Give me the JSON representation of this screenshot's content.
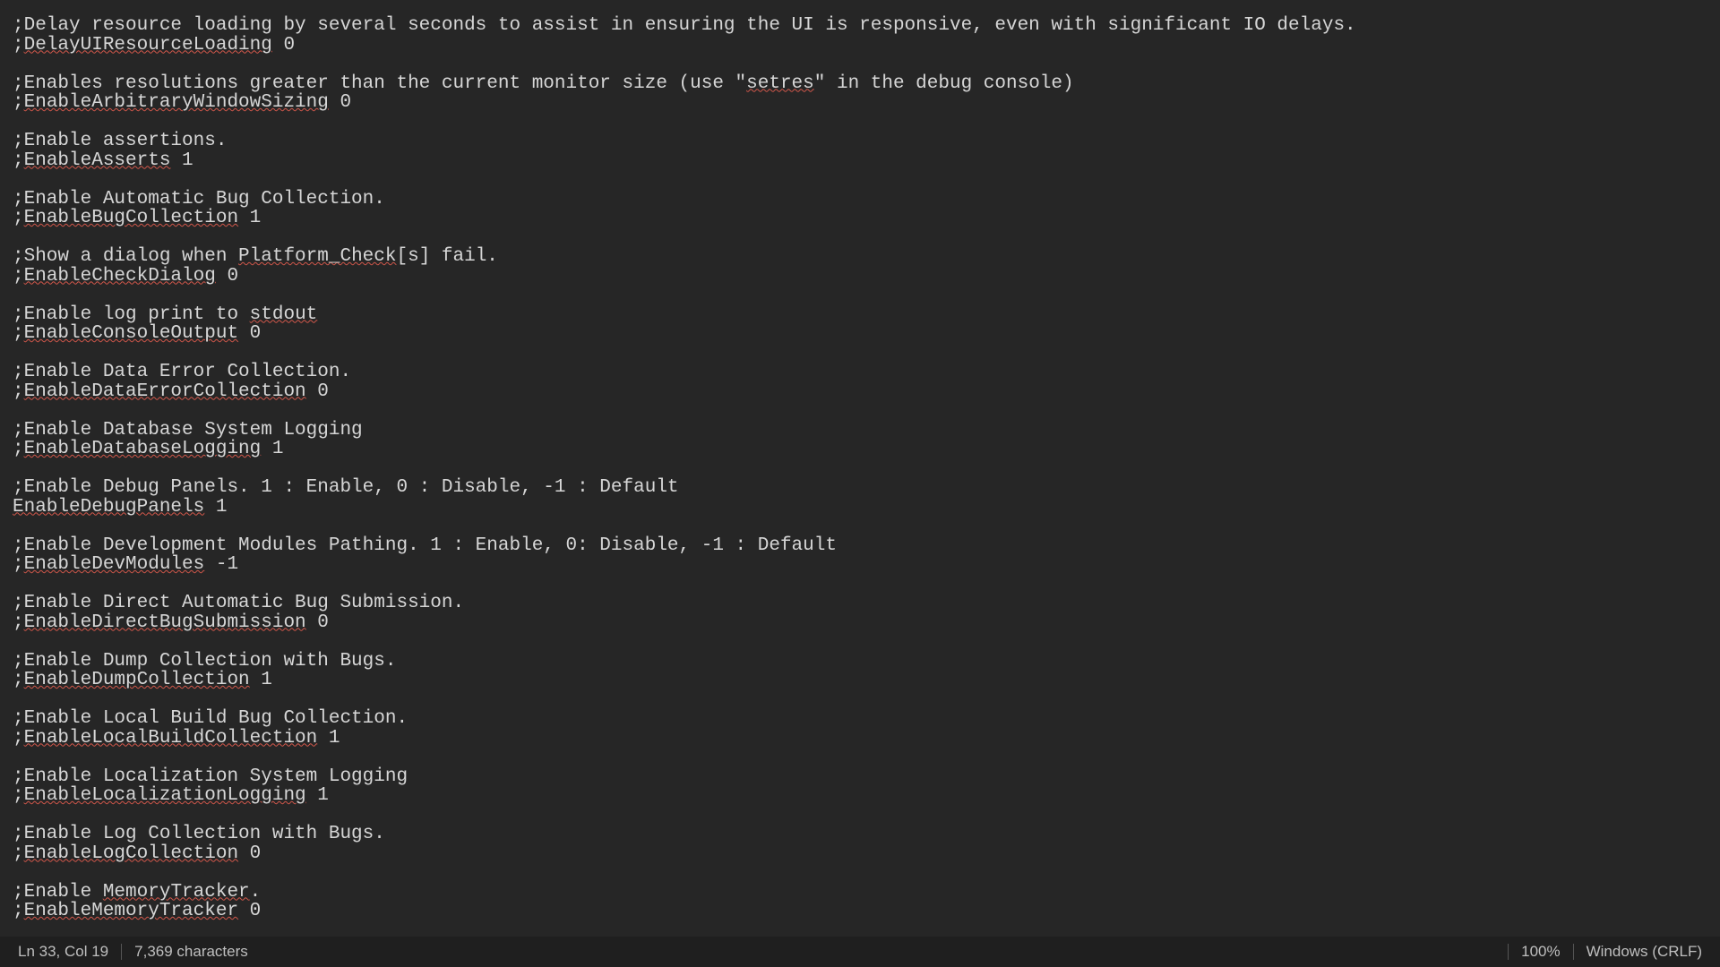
{
  "editor": {
    "lines": [
      {
        "segments": [
          {
            "t": ";Delay resource loading by several seconds to assist in ensuring the UI is responsive, even with significant IO delays."
          }
        ]
      },
      {
        "segments": [
          {
            "t": ";"
          },
          {
            "t": "DelayUIResourceLoading",
            "u": true
          },
          {
            "t": " 0"
          }
        ]
      },
      {
        "segments": []
      },
      {
        "segments": [
          {
            "t": ";Enables resolutions greater than the current monitor size (use \""
          },
          {
            "t": "setres",
            "u": true
          },
          {
            "t": "\" in the debug console)"
          }
        ]
      },
      {
        "segments": [
          {
            "t": ";"
          },
          {
            "t": "EnableArbitraryWindowSizing",
            "u": true
          },
          {
            "t": " 0"
          }
        ]
      },
      {
        "segments": []
      },
      {
        "segments": [
          {
            "t": ";Enable assertions."
          }
        ]
      },
      {
        "segments": [
          {
            "t": ";"
          },
          {
            "t": "EnableAsserts",
            "u": true
          },
          {
            "t": " 1"
          }
        ]
      },
      {
        "segments": []
      },
      {
        "segments": [
          {
            "t": ";Enable Automatic Bug Collection."
          }
        ]
      },
      {
        "segments": [
          {
            "t": ";"
          },
          {
            "t": "EnableBugCollection",
            "u": true
          },
          {
            "t": " 1"
          }
        ]
      },
      {
        "segments": []
      },
      {
        "segments": [
          {
            "t": ";Show a dialog when "
          },
          {
            "t": "Platform_Check",
            "u": true
          },
          {
            "t": "[s] fail."
          }
        ]
      },
      {
        "segments": [
          {
            "t": ";"
          },
          {
            "t": "EnableCheckDialog",
            "u": true
          },
          {
            "t": " 0"
          }
        ]
      },
      {
        "segments": []
      },
      {
        "segments": [
          {
            "t": ";Enable log print to "
          },
          {
            "t": "stdout",
            "u": true
          }
        ]
      },
      {
        "segments": [
          {
            "t": ";"
          },
          {
            "t": "EnableConsoleOutput",
            "u": true
          },
          {
            "t": " 0"
          }
        ]
      },
      {
        "segments": []
      },
      {
        "segments": [
          {
            "t": ";Enable Data Error Collection."
          }
        ]
      },
      {
        "segments": [
          {
            "t": ";"
          },
          {
            "t": "EnableDataErrorCollection",
            "u": true
          },
          {
            "t": " 0"
          }
        ]
      },
      {
        "segments": []
      },
      {
        "segments": [
          {
            "t": ";Enable Database System Logging"
          }
        ]
      },
      {
        "segments": [
          {
            "t": ";"
          },
          {
            "t": "EnableDatabaseLogging",
            "u": true
          },
          {
            "t": " 1"
          }
        ]
      },
      {
        "segments": []
      },
      {
        "segments": [
          {
            "t": ";Enable Debug Panels. 1 : Enable, 0 : Disable, -1 : Default"
          }
        ]
      },
      {
        "segments": [
          {
            "t": "EnableDebugPanels",
            "u": true
          },
          {
            "t": " 1"
          }
        ]
      },
      {
        "segments": []
      },
      {
        "segments": [
          {
            "t": ";Enable Development Modules Pathing. 1 : Enable, 0: Disable, -1 : Default"
          }
        ]
      },
      {
        "segments": [
          {
            "t": ";"
          },
          {
            "t": "EnableDevModules",
            "u": true
          },
          {
            "t": " -1"
          }
        ]
      },
      {
        "segments": []
      },
      {
        "segments": [
          {
            "t": ";Enable Direct Automatic Bug Submission."
          }
        ]
      },
      {
        "segments": [
          {
            "t": ";"
          },
          {
            "t": "EnableDirectBugSubmission",
            "u": true
          },
          {
            "t": " 0"
          }
        ]
      },
      {
        "segments": []
      },
      {
        "segments": [
          {
            "t": ";Enable Dump Collection with Bugs."
          }
        ]
      },
      {
        "segments": [
          {
            "t": ";"
          },
          {
            "t": "EnableDumpCollection",
            "u": true
          },
          {
            "t": " 1"
          }
        ]
      },
      {
        "segments": []
      },
      {
        "segments": [
          {
            "t": ";Enable Local Build Bug Collection."
          }
        ]
      },
      {
        "segments": [
          {
            "t": ";"
          },
          {
            "t": "EnableLocalBuildCollection",
            "u": true
          },
          {
            "t": " 1"
          }
        ]
      },
      {
        "segments": []
      },
      {
        "segments": [
          {
            "t": ";Enable Localization System Logging"
          }
        ]
      },
      {
        "segments": [
          {
            "t": ";"
          },
          {
            "t": "EnableLocalizationLogging",
            "u": true
          },
          {
            "t": " 1"
          }
        ]
      },
      {
        "segments": []
      },
      {
        "segments": [
          {
            "t": ";Enable Log Collection with Bugs."
          }
        ]
      },
      {
        "segments": [
          {
            "t": ";"
          },
          {
            "t": "EnableLogCollection",
            "u": true
          },
          {
            "t": " 0"
          }
        ]
      },
      {
        "segments": []
      },
      {
        "segments": [
          {
            "t": ";Enable "
          },
          {
            "t": "MemoryTracker",
            "u": true
          },
          {
            "t": "."
          }
        ]
      },
      {
        "segments": [
          {
            "t": ";"
          },
          {
            "t": "EnableMemoryTracker",
            "u": true
          },
          {
            "t": " 0"
          }
        ]
      }
    ]
  },
  "statusbar": {
    "position": "Ln 33, Col 19",
    "chars": "7,369 characters",
    "zoom": "100%",
    "lineending": "Windows (CRLF)"
  }
}
